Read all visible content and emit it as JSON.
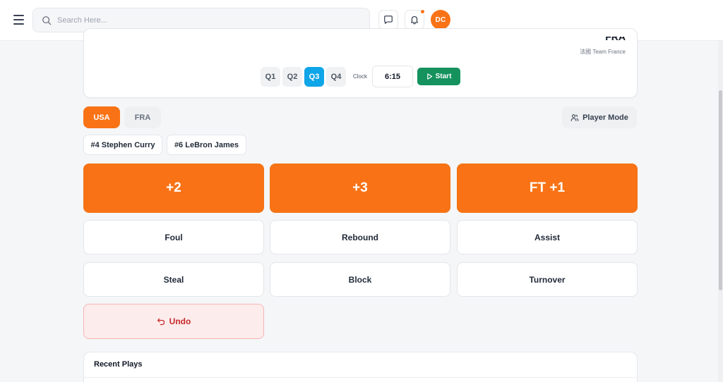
{
  "header": {
    "search_placeholder": "Search Here...",
    "avatar_initials": "DC",
    "accent_color": "#f97316",
    "has_notification": true
  },
  "game": {
    "away_team_abbr": "FRA",
    "away_team_name": "法國 Team France",
    "quarters": [
      "Q1",
      "Q2",
      "Q3",
      "Q4"
    ],
    "active_quarter": "Q3",
    "clock_label": "Clock",
    "clock_value": "6:15",
    "start_label": "Start"
  },
  "teams": {
    "tabs": [
      "USA",
      "FRA"
    ],
    "active": "USA",
    "player_mode_label": "Player Mode"
  },
  "players": [
    "#4 Stephen Curry",
    "#6 LeBron James"
  ],
  "actions": {
    "scoring": [
      "+2",
      "+3",
      "FT +1"
    ],
    "stats_row1": [
      "Foul",
      "Rebound",
      "Assist"
    ],
    "stats_row2": [
      "Steal",
      "Block",
      "Turnover"
    ],
    "undo_label": "Undo"
  },
  "recent": {
    "title": "Recent Plays"
  }
}
